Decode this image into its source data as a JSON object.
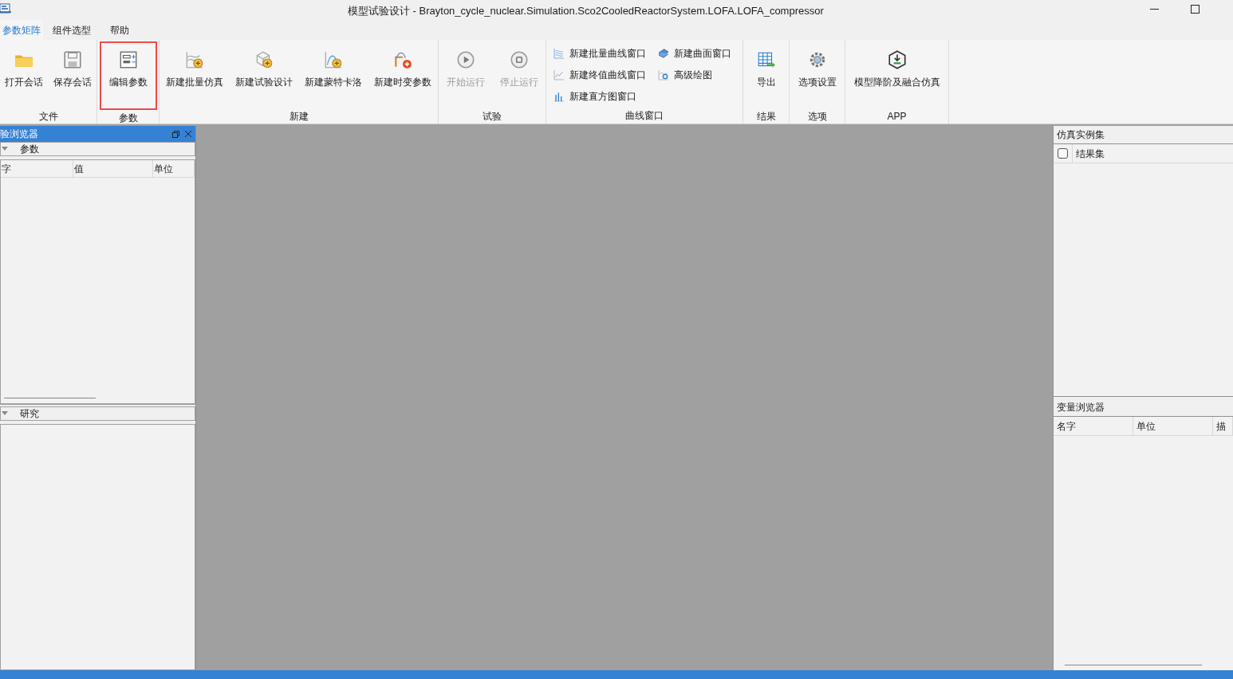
{
  "window": {
    "title": "模型试验设计 - Brayton_cycle_nuclear.Simulation.Sco2CooledReactorSystem.LOFA.LOFA_compressor"
  },
  "tabs": [
    {
      "label": "参数矩阵",
      "selected": true
    },
    {
      "label": "组件选型",
      "selected": false
    },
    {
      "label": "帮助",
      "selected": false
    }
  ],
  "ribbon": {
    "groups": [
      {
        "label": "文件",
        "kind": "large",
        "items": [
          {
            "label": "打开会话",
            "disabled": false
          },
          {
            "label": "保存会话",
            "disabled": false
          }
        ]
      },
      {
        "label": "参数",
        "kind": "large",
        "items": [
          {
            "label": "编辑参数",
            "disabled": false,
            "highlighted": true
          }
        ]
      },
      {
        "label": "新建",
        "kind": "large",
        "items": [
          {
            "label": "新建批量仿真",
            "disabled": false
          },
          {
            "label": "新建试验设计",
            "disabled": false
          },
          {
            "label": "新建蒙特卡洛",
            "disabled": false
          },
          {
            "label": "新建时变参数",
            "disabled": false
          }
        ]
      },
      {
        "label": "试验",
        "kind": "large",
        "items": [
          {
            "label": "开始运行",
            "disabled": true
          },
          {
            "label": "停止运行",
            "disabled": true
          }
        ]
      },
      {
        "label": "曲线窗口",
        "kind": "small",
        "items": [
          {
            "label": "新建批量曲线窗口",
            "disabled": false
          },
          {
            "label": "新建终值曲线窗口",
            "disabled": false
          },
          {
            "label": "新建直方图窗口",
            "disabled": false
          },
          {
            "label": "新建曲面窗口",
            "disabled": false
          },
          {
            "label": "高级绘图",
            "disabled": false
          }
        ]
      },
      {
        "label": "结果",
        "kind": "large",
        "items": [
          {
            "label": "导出",
            "disabled": false
          }
        ]
      },
      {
        "label": "选项",
        "kind": "large",
        "items": [
          {
            "label": "选项设置",
            "disabled": false
          }
        ]
      },
      {
        "label": "APP",
        "kind": "large",
        "items": [
          {
            "label": "模型降阶及融合仿真",
            "disabled": false
          }
        ]
      }
    ]
  },
  "left_panel": {
    "title": "验浏览器",
    "sections": [
      {
        "label": "参数",
        "expanded": true,
        "columns": [
          "字",
          "值",
          "单位"
        ]
      },
      {
        "label": "研究",
        "expanded": true
      }
    ]
  },
  "right_panel": {
    "instances": {
      "title": "仿真实例集",
      "items": [
        {
          "label": "结果集",
          "checked": false
        }
      ]
    },
    "variables": {
      "title": "变量浏览器",
      "columns": [
        "名字",
        "单位",
        "描"
      ]
    }
  }
}
